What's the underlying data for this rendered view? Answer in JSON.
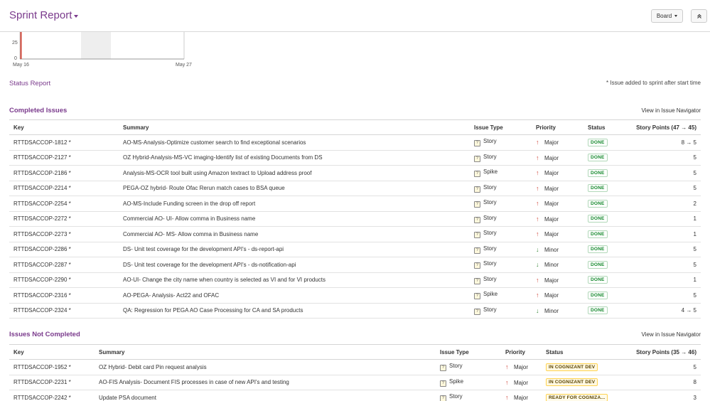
{
  "header": {
    "title": "Sprint Report",
    "board_label": "Board",
    "collapse_icon": "double-chevron-up-icon"
  },
  "chart": {
    "y_ticks": [
      "25",
      "0"
    ],
    "x_ticks": [
      "May 16",
      "May 27"
    ]
  },
  "status_report": {
    "link": "Status Report",
    "note": "* Issue added to sprint after start time"
  },
  "completed": {
    "title": "Completed Issues",
    "nav_link": "View in Issue Navigator",
    "columns": [
      "Key",
      "Summary",
      "Issue Type",
      "Priority",
      "Status",
      "Story Points (47 → 45)"
    ],
    "rows": [
      {
        "key": "RTTDSACCOP-1812 *",
        "summary": "AO-MS-Analysis-Optimize customer search to find exceptional scenarios",
        "type": "Story",
        "priority": "Major",
        "status": "DONE",
        "points": "8 → 5"
      },
      {
        "key": "RTTDSACCOP-2127 *",
        "summary": "OZ Hybrid-Analysis-MS-VC imaging-Identify list of existing Documents from DS",
        "type": "Story",
        "priority": "Major",
        "status": "DONE",
        "points": "5"
      },
      {
        "key": "RTTDSACCOP-2186 *",
        "summary": "Analysis-MS-OCR tool built using Amazon textract to Upload address proof",
        "type": "Spike",
        "priority": "Major",
        "status": "DONE",
        "points": "5"
      },
      {
        "key": "RTTDSACCOP-2214 *",
        "summary": "PEGA-OZ hybrid- Route Ofac Rerun match cases to BSA queue",
        "type": "Story",
        "priority": "Major",
        "status": "DONE",
        "points": "5"
      },
      {
        "key": "RTTDSACCOP-2254 *",
        "summary": "AO-MS-Include Funding screen in the drop off report",
        "type": "Story",
        "priority": "Major",
        "status": "DONE",
        "points": "2"
      },
      {
        "key": "RTTDSACCOP-2272 *",
        "summary": "Commercial AO- UI- Allow comma in Business name",
        "type": "Story",
        "priority": "Major",
        "status": "DONE",
        "points": "1"
      },
      {
        "key": "RTTDSACCOP-2273 *",
        "summary": "Commercial AO- MS- Allow comma in Business name",
        "type": "Story",
        "priority": "Major",
        "status": "DONE",
        "points": "1"
      },
      {
        "key": "RTTDSACCOP-2286 *",
        "summary": "DS- Unit test coverage for the development API's - ds-report-api",
        "type": "Story",
        "priority": "Minor",
        "status": "DONE",
        "points": "5"
      },
      {
        "key": "RTTDSACCOP-2287 *",
        "summary": "DS- Unit test coverage for the development API's - ds-notification-api",
        "type": "Story",
        "priority": "Minor",
        "status": "DONE",
        "points": "5"
      },
      {
        "key": "RTTDSACCOP-2290 *",
        "summary": "AO-UI- Change the city name when country is selected as VI and for VI products",
        "type": "Story",
        "priority": "Major",
        "status": "DONE",
        "points": "1"
      },
      {
        "key": "RTTDSACCOP-2316 *",
        "summary": "AO-PEGA- Analysis- Act22 and OFAC",
        "type": "Spike",
        "priority": "Major",
        "status": "DONE",
        "points": "5"
      },
      {
        "key": "RTTDSACCOP-2324 *",
        "summary": "QA: Regression for PEGA AO Case Processing for CA and SA products",
        "type": "Story",
        "priority": "Minor",
        "status": "DONE",
        "points": "4 → 5"
      }
    ]
  },
  "not_completed": {
    "title": "Issues Not Completed",
    "nav_link": "View in Issue Navigator",
    "columns": [
      "Key",
      "Summary",
      "Issue Type",
      "Priority",
      "Status",
      "Story Points (35 → 46)"
    ],
    "rows": [
      {
        "key": "RTTDSACCOP-1952 *",
        "summary": "OZ Hybrid- Debit card Pin request analysis",
        "type": "Story",
        "priority": "Major",
        "status": "IN COGNIZANT DEV",
        "points": "5"
      },
      {
        "key": "RTTDSACCOP-2231 *",
        "summary": "AO-FIS Analysis- Document FIS processes in case of new API's and testing",
        "type": "Spike",
        "priority": "Major",
        "status": "IN COGNIZANT DEV",
        "points": "8"
      },
      {
        "key": "RTTDSACCOP-2242 *",
        "summary": "Update PSA document",
        "type": "Story",
        "priority": "Major",
        "status": "READY FOR COGNIZA...",
        "points": "3"
      }
    ]
  },
  "colors": {
    "accent": "#7a3a8c",
    "done": "#14892c",
    "major": "#d04437",
    "minor": "#3b8a3b"
  }
}
